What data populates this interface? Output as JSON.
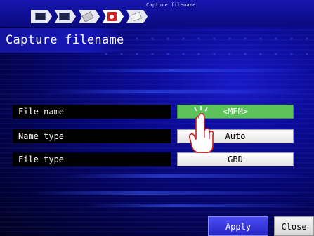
{
  "header": {
    "step_indicator": "Capture filename",
    "steps": [
      {
        "icon": "monitor-icon"
      },
      {
        "icon": "list-icon"
      },
      {
        "icon": "card-icon"
      },
      {
        "icon": "record-icon",
        "active": true
      },
      {
        "icon": "tag-icon"
      }
    ]
  },
  "page": {
    "title": "Capture filename"
  },
  "form": {
    "rows": [
      {
        "label": "File name",
        "value": "<MEM>",
        "selected": true
      },
      {
        "label": "Name type",
        "value": "Auto",
        "selected": false
      },
      {
        "label": "File type",
        "value": "GBD",
        "selected": false
      }
    ]
  },
  "buttons": {
    "apply": "Apply",
    "close": "Close"
  },
  "colors": {
    "background": "#0c0c9a",
    "selected_field": "#5cc25a",
    "apply_button": "#3535de"
  }
}
